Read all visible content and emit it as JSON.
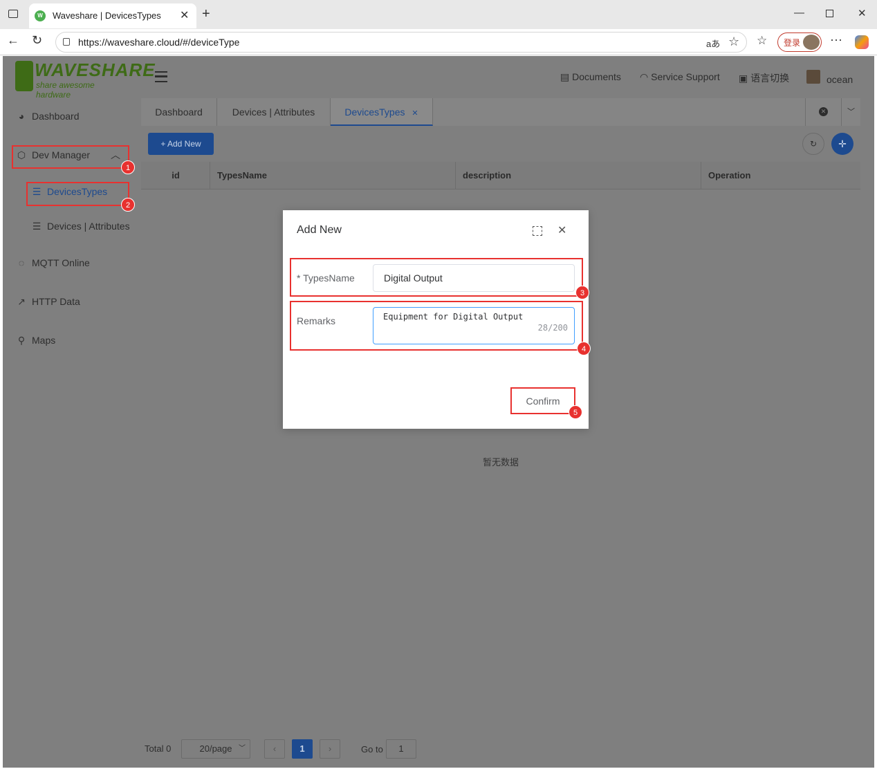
{
  "browser": {
    "tab_title": "Waveshare | DevicesTypes",
    "url": "https://waveshare.cloud/#/deviceType",
    "login_label": "登录",
    "translate_label": "aあ"
  },
  "brand": {
    "name": "WAVESHARE",
    "tagline": "share awesome hardware"
  },
  "sidebar": {
    "items": [
      {
        "label": "Dashboard",
        "icon": "pie-chart-icon"
      },
      {
        "label": "Dev Manager",
        "icon": "cube-icon"
      },
      {
        "label": "DevicesTypes",
        "icon": "list-icon"
      },
      {
        "label": "Devices | Attributes",
        "icon": "list-icon"
      },
      {
        "label": "MQTT Online",
        "icon": "chat-icon"
      },
      {
        "label": "HTTP Data",
        "icon": "line-chart-icon"
      },
      {
        "label": "Maps",
        "icon": "location-icon"
      }
    ]
  },
  "header": {
    "documents": "Documents",
    "service_support": "Service Support",
    "language": "语言切换",
    "username": "ocean"
  },
  "tabs": [
    "Dashboard",
    "Devices | Attributes",
    "DevicesTypes"
  ],
  "toolbar": {
    "add_new": "+ Add New"
  },
  "table": {
    "columns": [
      "id",
      "TypesName",
      "description",
      "Operation"
    ],
    "empty_text": "暂无数据"
  },
  "pagination": {
    "total": "Total 0",
    "page_size": "20/page",
    "current_page": "1",
    "goto_label": "Go to",
    "goto_value": "1"
  },
  "dialog": {
    "title": "Add New",
    "types_name_label": "* TypesName",
    "types_name_value": "Digital Output",
    "remarks_label": "Remarks",
    "remarks_value": "Equipment for Digital Output",
    "remarks_counter": "28/200",
    "confirm": "Confirm"
  },
  "annotations": [
    "1",
    "2",
    "3",
    "4",
    "5"
  ],
  "colors": {
    "accent": "#1d4a8f",
    "highlight": "#e8312f",
    "brand": "#3e6b16"
  }
}
